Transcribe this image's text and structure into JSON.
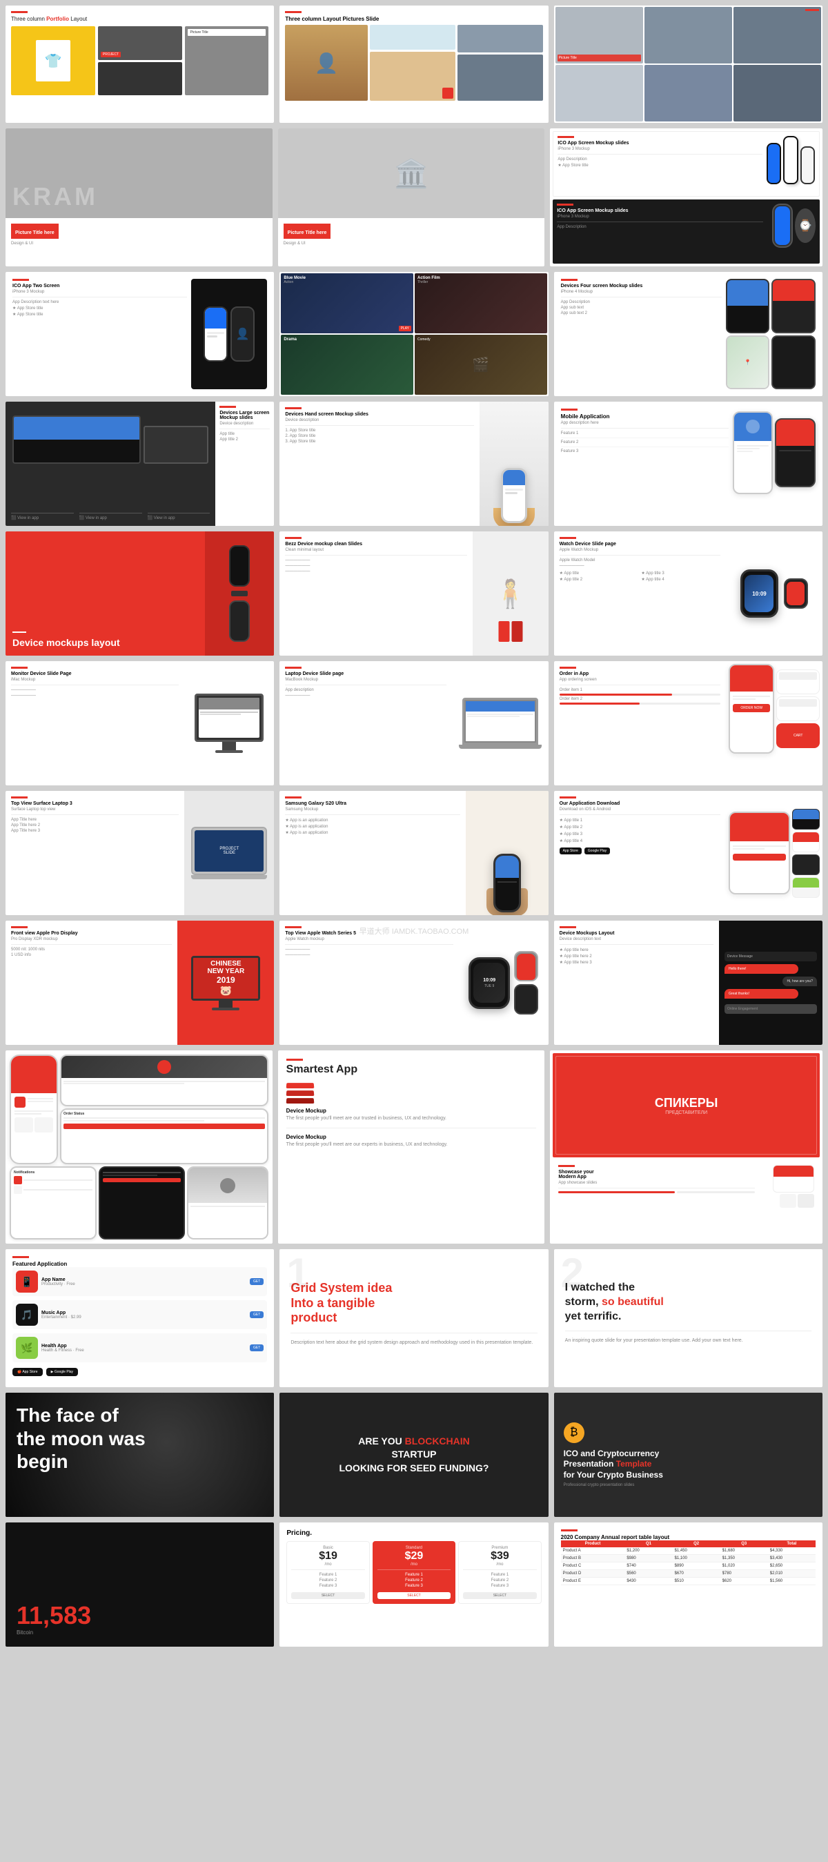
{
  "watermark": "早道大师 IAMDK.TAOBAO.COM",
  "accent": "#e63329",
  "slides": {
    "row1": {
      "s1": {
        "title": "Three column Portfolio Layout",
        "highlight": "Portfolio"
      },
      "s2": {
        "title": "Three column Layout Pictures Slide"
      },
      "s3": {
        "title": ""
      }
    },
    "row2": {
      "s1": {
        "title": "Picture Title here",
        "sub": "Design & UI"
      },
      "s2": {
        "title": "Picture Title here",
        "sub": "Design & UI"
      },
      "s3a": {
        "title": "ICO App Screen Mockup slides"
      },
      "s3b": {
        "title": "ICO App Screen Mockup slides"
      }
    },
    "row3": {
      "s1": {
        "title": "ICO App Two Screen"
      },
      "s2": {
        "title": ""
      },
      "s3": {
        "title": "Devices Four screen Mockup slides"
      }
    },
    "row4": {
      "s1": {
        "title": "Devices Large screen Mockup slides"
      },
      "s2": {
        "title": "Devices Hand screen Mockup slides"
      },
      "s3": {
        "title": "Mobile Application"
      }
    },
    "row5": {
      "s1": {
        "title": "Device mockups layout"
      },
      "s2": {
        "title": "Bezz Device mockup clean Slides"
      },
      "s3": {
        "title": "Watch Device Slide page"
      }
    },
    "row6": {
      "s1": {
        "title": "Monitor Device Slide Page"
      },
      "s2": {
        "title": "Laptop Device Slide page"
      },
      "s3": {
        "title": "Order in App"
      }
    },
    "row7": {
      "s1": {
        "title": "Top View Surface Laptop 3"
      },
      "s2": {
        "title": "Samsung Galaxy S20 Ultra"
      },
      "s3": {
        "title": "Our Application Download"
      }
    },
    "row8": {
      "s1": {
        "title": "Front view Apple Pro Display"
      },
      "s2": {
        "title": "Top View Apple Watch Series 5"
      },
      "s3": {
        "title": "Device Mockups Layout"
      }
    },
    "row9": {
      "s1": {
        "title": ""
      },
      "s2": {
        "title": "Smartest App",
        "sub": "Device Mockup",
        "body": "The first people you'll meet are our trusted in business, UX and technology."
      },
      "s3": {
        "title": "СПИКЕРЫ"
      }
    },
    "row10": {
      "s1": {
        "title": "Featured Application"
      },
      "s2": {
        "title": "Grid System idea Into a tangible product",
        "num": "1"
      },
      "s3": {
        "title": "I watched the storm, so beautiful yet terrific.",
        "num": "2"
      }
    },
    "row11": {
      "s1": {
        "title": "The face of the moon was begin"
      },
      "s2": {
        "title": "ARE YOU BLOCKCHAIN STARTUP LOOKING FOR SEED FUNDING?",
        "highlight": "BLOCKCHAIN"
      },
      "s3": {
        "title": "ICO and Cryptocurrency Presentation Template for Your Crypto Business"
      }
    },
    "row12": {
      "s1": {
        "title": "11,583",
        "sub": "Bitcoin"
      },
      "s2": {
        "title": "Pricing.",
        "plans": [
          {
            "name": "Basic",
            "price": "$19",
            "period": "mo"
          },
          {
            "name": "Standard",
            "price": "$29",
            "period": "mo"
          },
          {
            "name": "Premium",
            "price": "$39",
            "period": "mo"
          }
        ]
      },
      "s3": {
        "title": "2020 Company Annual report table layout"
      }
    }
  }
}
